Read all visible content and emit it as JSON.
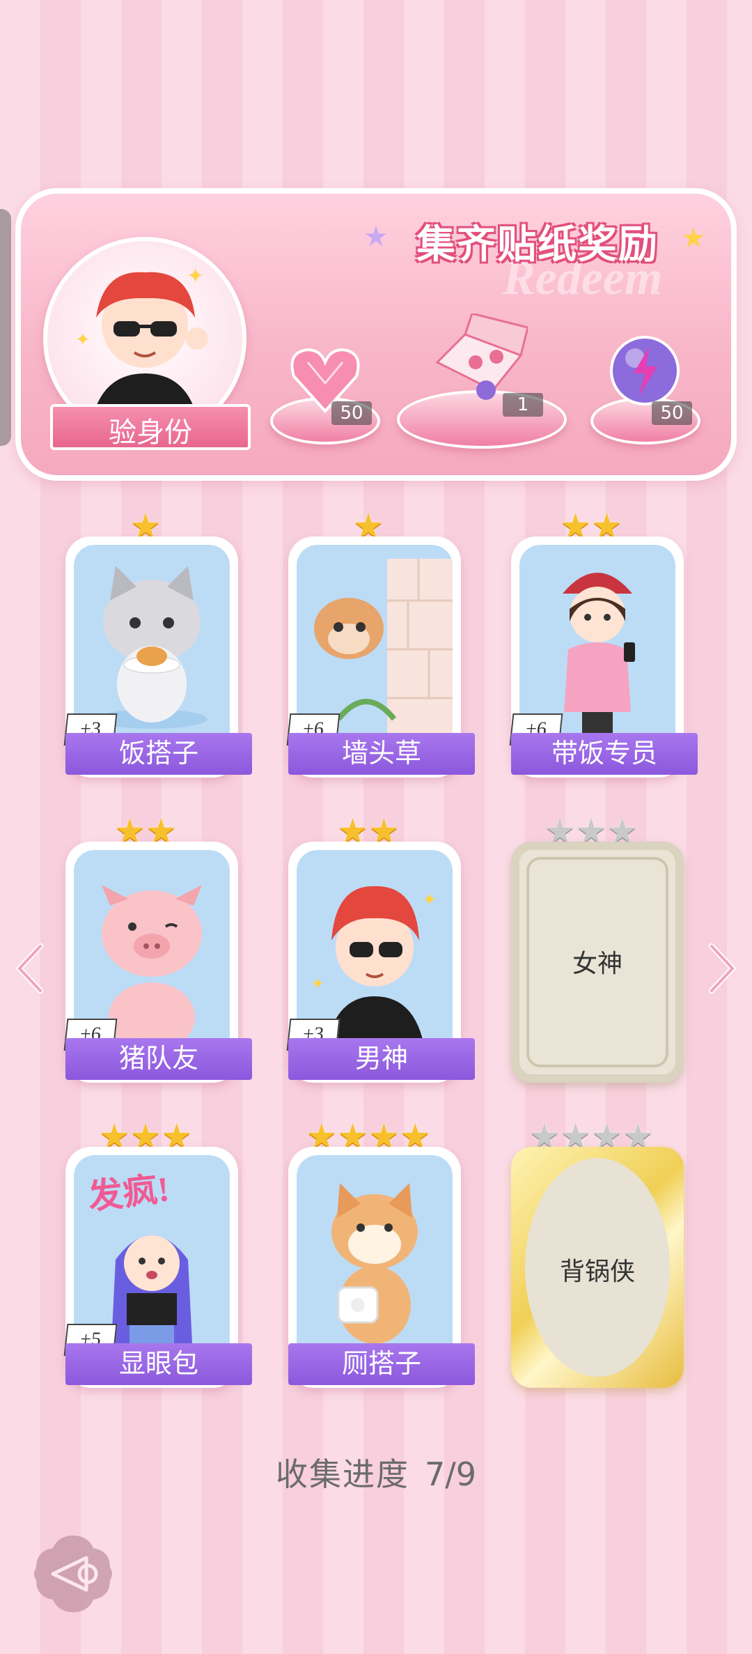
{
  "banner": {
    "title": "集齐贴纸奖励",
    "watermark": "Redeem",
    "verify_label": "验身份",
    "rewards": [
      {
        "icon": "pink-heart-gem-icon",
        "count": "50"
      },
      {
        "icon": "gift-box-icon",
        "count": "1"
      },
      {
        "icon": "purple-lightning-orb-icon",
        "count": "50"
      }
    ]
  },
  "cards": [
    {
      "name": "饭搭子",
      "stars": "★",
      "bonus": "+3",
      "art": "cat-with-pancake-icon"
    },
    {
      "name": "墙头草",
      "stars": "★",
      "bonus": "+6",
      "art": "squirrel-on-wall-icon"
    },
    {
      "name": "带饭专员",
      "stars": "★★",
      "bonus": "+6",
      "art": "girl-with-phone-icon"
    },
    {
      "name": "猪队友",
      "stars": "★★",
      "bonus": "+6",
      "art": "pig-icon"
    },
    {
      "name": "男神",
      "stars": "★★",
      "bonus": "+3",
      "art": "boy-with-sunglasses-icon"
    },
    {
      "name": "女神",
      "stars": "★★★",
      "locked": true
    },
    {
      "name": "显眼包",
      "stars": "★★★",
      "bonus": "+5",
      "art": "girl-crazy-icon",
      "art_text": "发疯!"
    },
    {
      "name": "厕搭子",
      "stars": "★★★★",
      "art": "shiba-with-toilet-paper-icon"
    },
    {
      "name": "背锅侠",
      "stars": "★★★★",
      "locked": true
    }
  ],
  "progress": {
    "label": "收集进度",
    "value": "7/9"
  },
  "colors": {
    "label_purple": "#9563e4",
    "star_gold": "#f7c12d",
    "accent_pink": "#e8668f"
  }
}
